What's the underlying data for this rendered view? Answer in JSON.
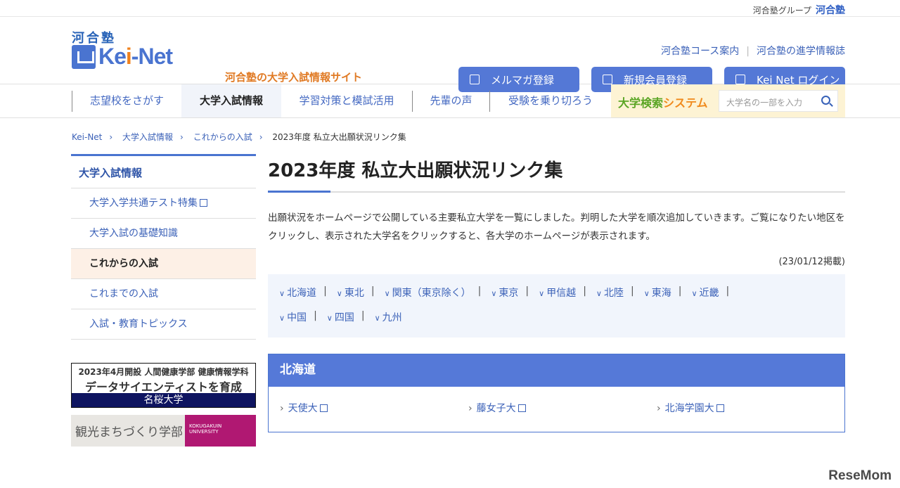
{
  "topbar": {
    "group": "河合塾グループ",
    "group_logo": "河合塾"
  },
  "header": {
    "logo_kanji": "河合塾",
    "logo_a": "Ke",
    "logo_i": "i",
    "logo_b": "-Net",
    "tagline": "河合塾の大学入試情報サイト",
    "links": [
      "河合塾コース案内",
      "河合塾の進学情報誌"
    ],
    "link_sep": "|",
    "buttons": [
      "メルマガ登録",
      "新規会員登録",
      "Kei Net ログイン"
    ]
  },
  "nav": {
    "items": [
      "志望校をさがす",
      "大学入試情報",
      "学習対策と模試活用",
      "先輩の声",
      "受験を乗り切ろう"
    ],
    "search_a": "大学検索",
    "search_b": "システム",
    "search_placeholder": "大学名の一部を入力"
  },
  "breadcrumb": [
    "Kei-Net",
    "大学入試情報",
    "これからの入試",
    "2023年度 私立大出願状況リンク集"
  ],
  "sidebar": {
    "heading": "大学入試情報",
    "items": [
      "大学入学共通テスト特集",
      "大学入試の基礎知識",
      "これからの入試",
      "これまでの入試",
      "入試・教育トピックス"
    ]
  },
  "banners": {
    "b1_top": "2023年4月開設 人間健康学部 健康情報学科",
    "b1_mid": "データサイエンティストを育成",
    "b1_bottom": "名桜大学",
    "b2_text": "観光まちづくり学部",
    "b2_brand": "KOKUGAKUIN UNIVERSITY"
  },
  "main": {
    "title": "2023年度 私立大出願状況リンク集",
    "lead": "出願状況をホームページで公開している主要私立大学を一覧にしました。判明した大学を順次追加していきます。ご覧になりたい地区をクリックし、表示された大学名をクリックすると、各大学のホームページが表示されます。",
    "date": "(23/01/12掲載)",
    "regions_row1": [
      "北海道",
      "東北",
      "関東（東京除く）",
      "東京",
      "甲信越",
      "北陸",
      "東海",
      "近畿"
    ],
    "regions_row2": [
      "中国",
      "四国",
      "九州"
    ],
    "region_sep": "|",
    "section": {
      "title": "北海道",
      "universities": [
        "天使大",
        "藤女子大",
        "北海学園大"
      ]
    }
  },
  "watermark": "ReseMom"
}
